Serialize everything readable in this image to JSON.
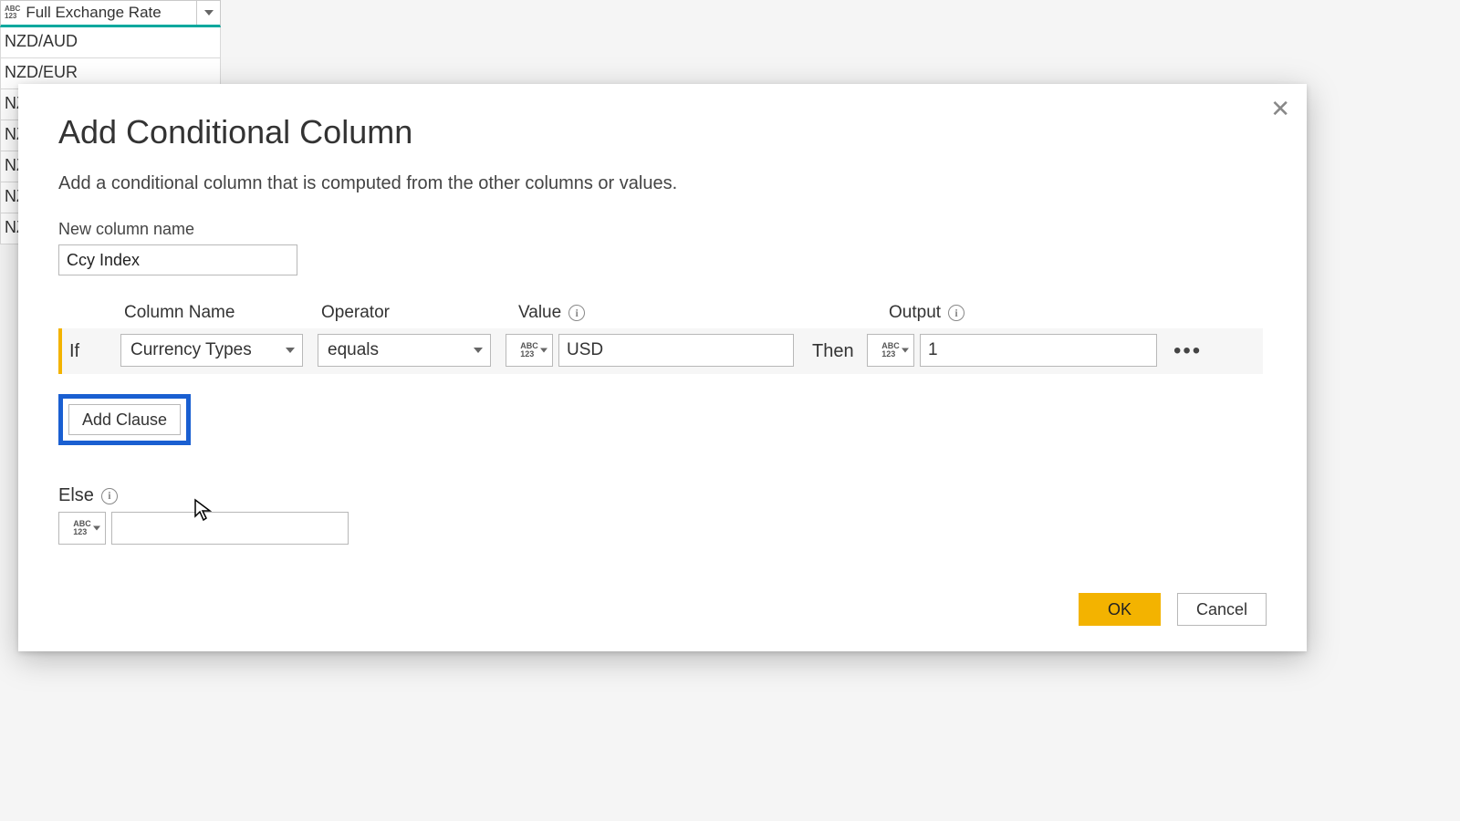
{
  "background": {
    "column_header": "Full Exchange Rate",
    "type_badge_top": "ABC",
    "type_badge_bot": "123",
    "rows": [
      "NZD/AUD",
      "NZD/EUR",
      "NZ",
      "NZ",
      "NZ",
      "NZ",
      "NZ"
    ]
  },
  "dialog": {
    "title": "Add Conditional Column",
    "subtitle": "Add a conditional column that is computed from the other columns or values.",
    "new_column_label": "New column name",
    "new_column_value": "Ccy Index",
    "headers": {
      "column_name": "Column Name",
      "operator": "Operator",
      "value": "Value",
      "output": "Output"
    },
    "clause": {
      "if_label": "If",
      "column_name": "Currency Types",
      "operator": "equals",
      "value": "USD",
      "then_label": "Then",
      "output": "1",
      "type_top": "ABC",
      "type_bot": "123"
    },
    "add_clause_label": "Add Clause",
    "else_label": "Else",
    "else_value": "",
    "ok_label": "OK",
    "cancel_label": "Cancel"
  }
}
